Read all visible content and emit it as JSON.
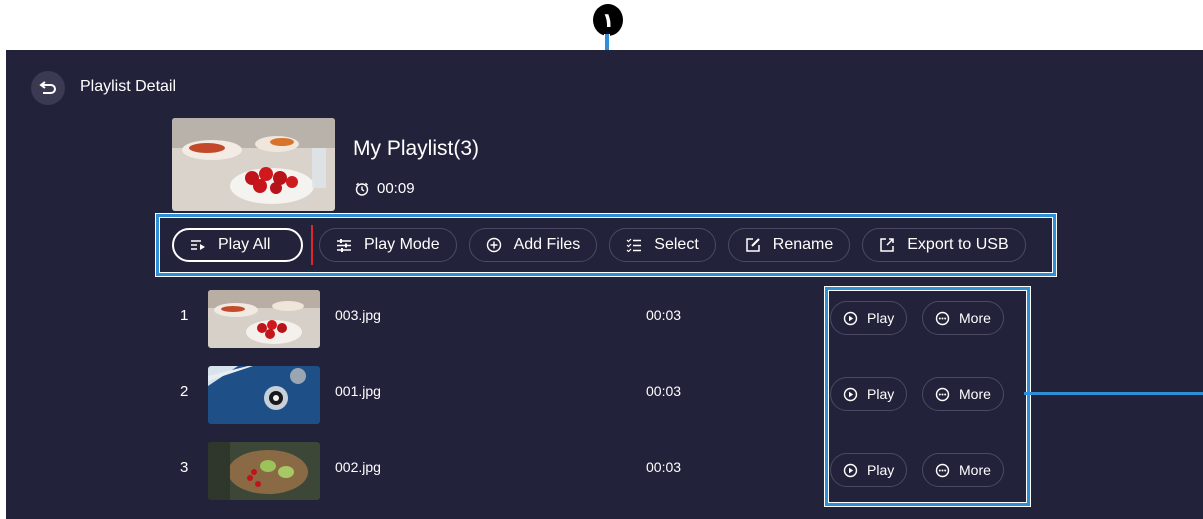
{
  "callout": {
    "number": "١"
  },
  "header": {
    "title": "Playlist Detail"
  },
  "playlist": {
    "title": "My Playlist(3)",
    "duration": "00:09"
  },
  "toolbar": {
    "play_all": "Play All",
    "play_mode": "Play Mode",
    "add_files": "Add Files",
    "select": "Select",
    "rename": "Rename",
    "export": "Export to USB"
  },
  "items": [
    {
      "index": "1",
      "name": "003.jpg",
      "duration": "00:03",
      "play": "Play",
      "more": "More"
    },
    {
      "index": "2",
      "name": "001.jpg",
      "duration": "00:03",
      "play": "Play",
      "more": "More"
    },
    {
      "index": "3",
      "name": "002.jpg",
      "duration": "00:03",
      "play": "Play",
      "more": "More"
    }
  ],
  "colors": {
    "background": "#22233a",
    "highlight": "#2f8fd6",
    "active_divider": "#e0262b"
  }
}
